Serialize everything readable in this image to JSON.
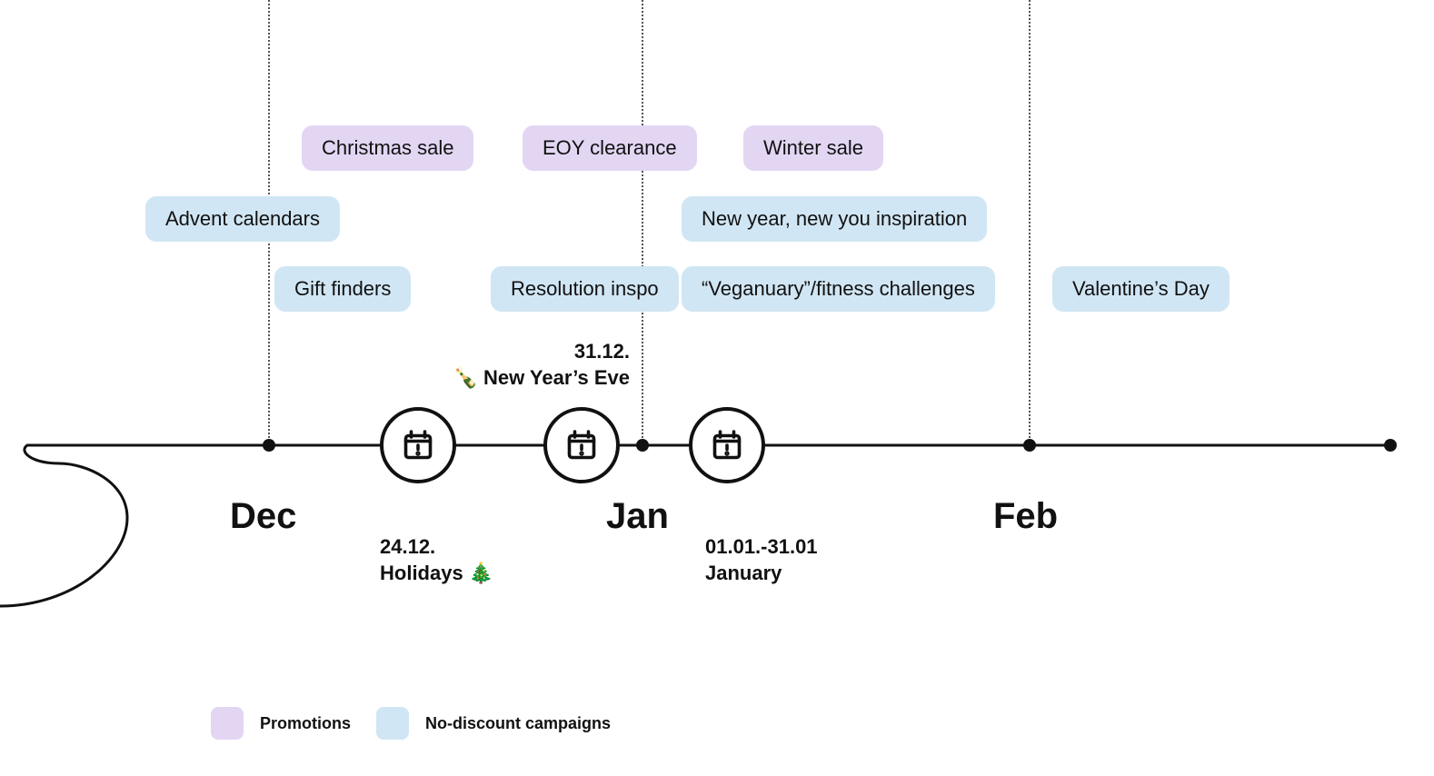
{
  "months": {
    "dec": "Dec",
    "jan": "Jan",
    "feb": "Feb"
  },
  "promotions": {
    "christmas_sale": "Christmas sale",
    "eoy_clearance": "EOY clearance",
    "winter_sale": "Winter sale"
  },
  "no_discount": {
    "advent_calendars": "Advent calendars",
    "gift_finders": "Gift finders",
    "resolution_inspo": "Resolution inspo",
    "new_year_new_you": "New year, new you inspiration",
    "veganuary": "“Veganuary”/fitness challenges",
    "valentines": "Valentine’s Day"
  },
  "milestones": {
    "holidays": {
      "date": "24.12.",
      "label": "Holidays 🎄"
    },
    "new_years_eve": {
      "date": "31.12.",
      "label": "🍾 New Year’s Eve"
    },
    "january": {
      "date": "01.01.-31.01",
      "label": "January"
    }
  },
  "legend": {
    "promotions": "Promotions",
    "no_discount": "No-discount campaigns"
  }
}
